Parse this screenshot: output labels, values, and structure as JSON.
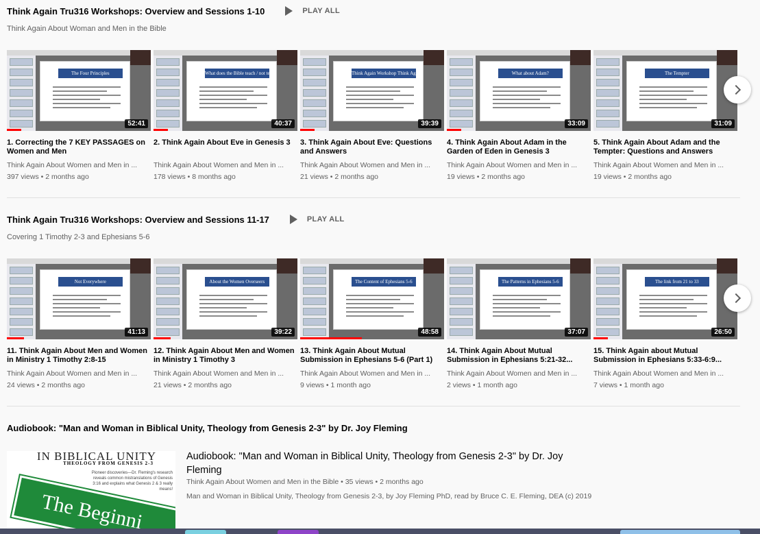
{
  "shelves": [
    {
      "title": "Think Again Tru316 Workshops: Overview and Sessions 1-10",
      "play_all": "PLAY ALL",
      "subtitle": "Think Again About Woman and Men in the Bible",
      "videos": [
        {
          "slide": "The Four Principles",
          "duration": "52:41",
          "progress": 0.1,
          "title": "1. Correcting the 7 KEY PASSAGES on Women and Men",
          "channel": "Think Again About Women and Men in ...",
          "views": "397 views",
          "age": "2 months ago"
        },
        {
          "slide": "What does the Bible teach / not teach / about Eve?",
          "duration": "40:37",
          "progress": 0.1,
          "title": "2. Think Again About Eve in Genesis 3",
          "channel": "Think Again About Women and Men in ...",
          "views": "178 views",
          "age": "8 months ago"
        },
        {
          "slide": "Think Again Workshop Think Again about Eve Question & Answer Session",
          "duration": "39:39",
          "progress": 0.1,
          "title": "3. Think Again About Eve: Questions and Answers",
          "channel": "Think Again About Women and Men in ...",
          "views": "21 views",
          "age": "2 months ago"
        },
        {
          "slide": "What about Adam?",
          "duration": "33:09",
          "progress": 0.1,
          "title": "4. Think Again About Adam in the Garden of Eden in Genesis 3",
          "channel": "Think Again About Women and Men in ...",
          "views": "19 views",
          "age": "2 months ago"
        },
        {
          "slide": "The Tempter",
          "duration": "31:09",
          "progress": 0,
          "title": "5. Think Again About Adam and the Tempter: Questions and Answers",
          "channel": "Think Again About Women and Men in ...",
          "views": "19 views",
          "age": "2 months ago"
        }
      ]
    },
    {
      "title": "Think Again Tru316 Workshops: Overview and Sessions 11-17",
      "play_all": "PLAY ALL",
      "subtitle": "Covering 1 Timothy 2-3 and Ephesians 5-6",
      "videos": [
        {
          "slide": "Not Everywhere",
          "duration": "41:13",
          "progress": 0.12,
          "title": "11. Think Again About Men and Women in Ministry 1 Timothy 2:8-15",
          "channel": "Think Again About Women and Men in ...",
          "views": "24 views",
          "age": "2 months ago"
        },
        {
          "slide": "About the Women Overseers",
          "duration": "39:22",
          "progress": 0.12,
          "title": "12. Think Again About Men and Women in Ministry 1 Timothy 3",
          "channel": "Think Again About Women and Men in ...",
          "views": "21 views",
          "age": "2 months ago"
        },
        {
          "slide": "The Content of Ephesians 5-6",
          "duration": "48:58",
          "progress": 0.43,
          "title": "13. Think Again About Mutual Submission in Ephesians 5-6 (Part 1)",
          "channel": "Think Again About Women and Men in ...",
          "views": "9 views",
          "age": "1 month ago"
        },
        {
          "slide": "The Patterns in Ephesians 5-6",
          "duration": "37:07",
          "progress": 0,
          "title": "14. Think Again About Mutual Submission in Ephesians 5:21-32...",
          "channel": "Think Again About Women and Men in ...",
          "views": "2 views",
          "age": "1 month ago"
        },
        {
          "slide": "The link from 21 to 33",
          "duration": "26:50",
          "progress": 0.1,
          "title": "15. Think Again about Mutual Submission in Ephesians 5:33-6:9...",
          "channel": "Think Again About Women and Men in ...",
          "views": "7 views",
          "age": "1 month ago"
        }
      ]
    }
  ],
  "audiobook": {
    "shelf_title": "Audiobook: \"Man and Woman in Biblical Unity, Theology from Genesis 2-3\" by Dr. Joy Fleming",
    "thumb_line1": "IN BIBLICAL UNITY",
    "thumb_line2": "THEOLOGY FROM GENESIS 2-3",
    "thumb_blurb": "Pioneer discoveries—Dr. Fleming's research reveals common mistranslations of Genesis 3:16 and explains what Genesis 2 & 3 really means!",
    "thumb_sign": "The Beginni",
    "title": "Audiobook: \"Man and Woman in Biblical Unity, Theology from Genesis 2-3\" by Dr. Joy Fleming",
    "channel": "Think Again About Women and Men in the Bible",
    "views": "35 views",
    "age": "2 months ago",
    "description": "Man and Woman in Biblical Unity, Theology from Genesis 2-3, by Joy Fleming PhD, read by Bruce C. E. Fleming, DEA (c) 2019"
  },
  "colors": {
    "accent": "#ff0000",
    "text": "#030303",
    "muted": "#606060",
    "background": "#f9f9f9"
  }
}
